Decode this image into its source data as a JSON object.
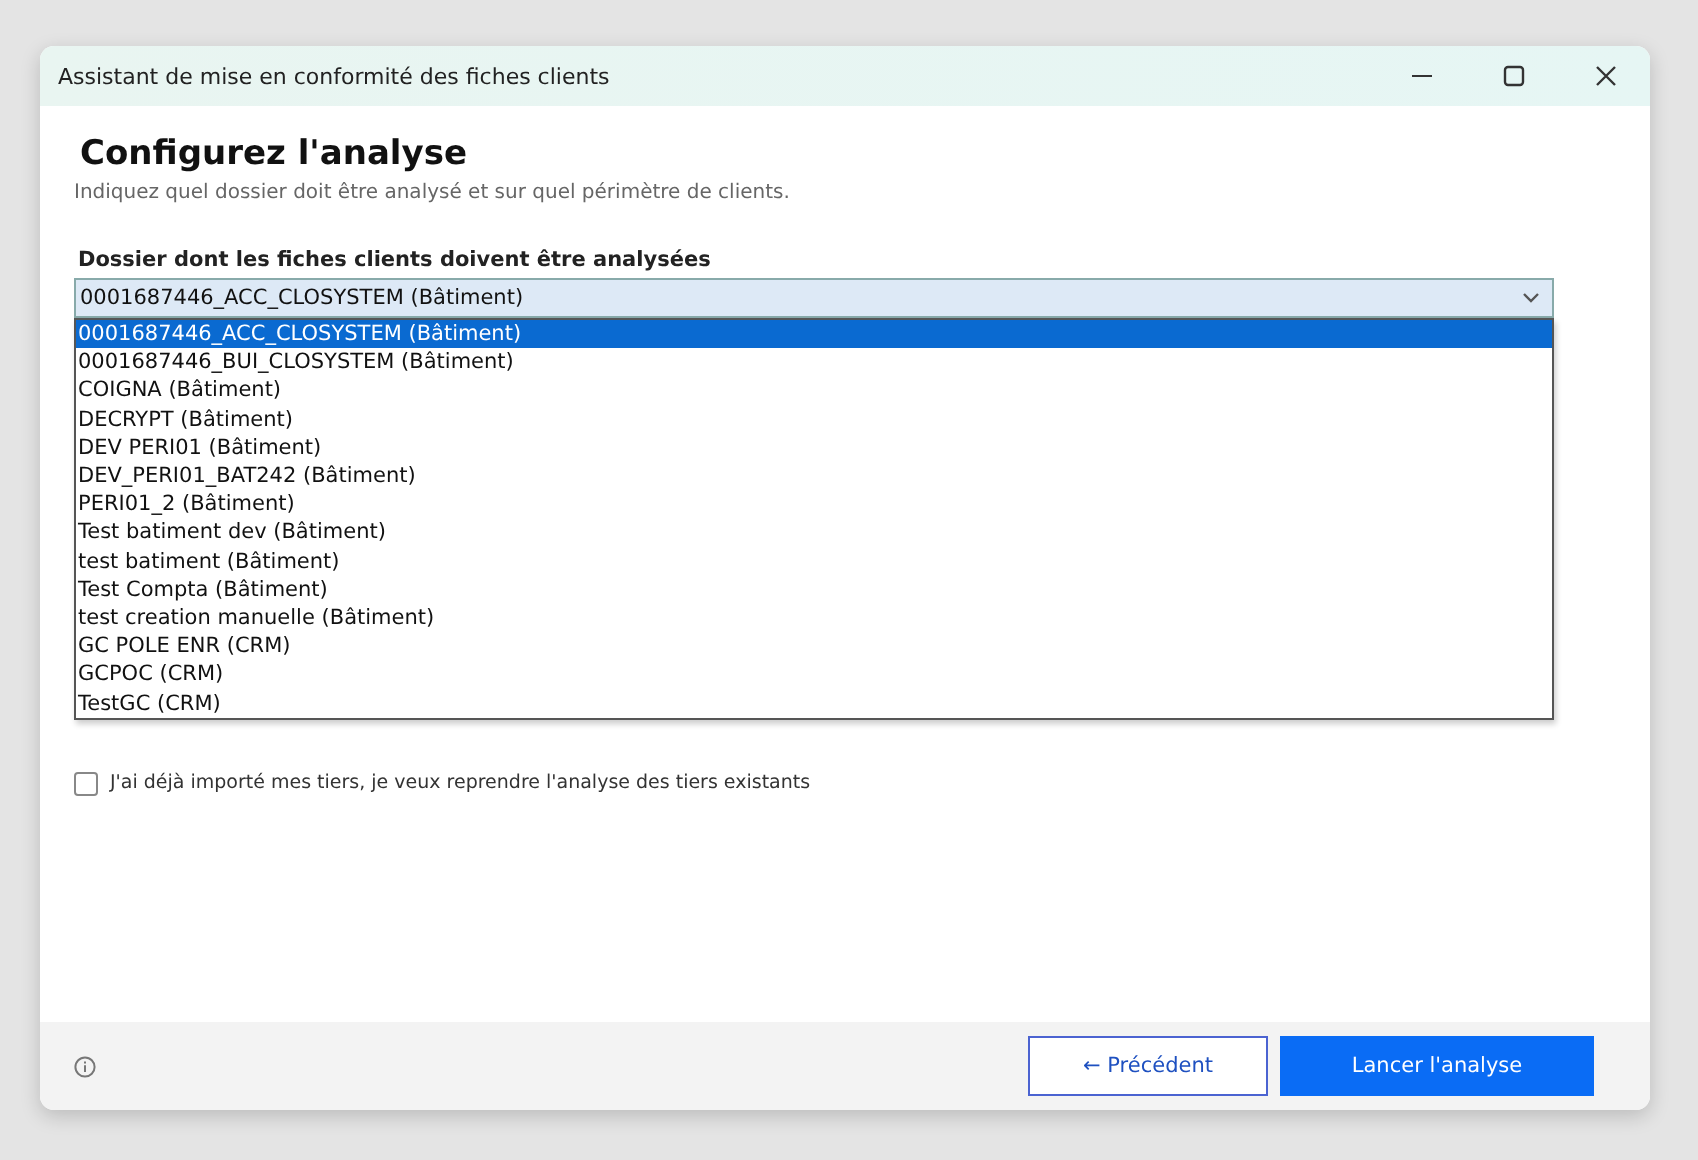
{
  "window": {
    "title": "Assistant de mise en conformité des fiches clients"
  },
  "heading": "Configurez l'analyse",
  "subtitle": "Indiquez quel dossier doit être analysé et sur quel périmètre de clients.",
  "folder_field": {
    "label": "Dossier dont les fiches clients doivent être analysées",
    "value": "0001687446_ACC_CLOSYSTEM (Bâtiment)",
    "expanded": true,
    "options": [
      {
        "label": "0001687446_ACC_CLOSYSTEM (Bâtiment)",
        "selected": true
      },
      {
        "label": "0001687446_BUI_CLOSYSTEM (Bâtiment)",
        "selected": false
      },
      {
        "label": "COIGNA (Bâtiment)",
        "selected": false
      },
      {
        "label": "DECRYPT (Bâtiment)",
        "selected": false
      },
      {
        "label": "DEV PERI01 (Bâtiment)",
        "selected": false
      },
      {
        "label": "DEV_PERI01_BAT242 (Bâtiment)",
        "selected": false
      },
      {
        "label": "PERI01_2 (Bâtiment)",
        "selected": false
      },
      {
        "label": "Test batiment dev (Bâtiment)",
        "selected": false
      },
      {
        "label": "test batiment (Bâtiment)",
        "selected": false
      },
      {
        "label": "Test Compta (Bâtiment)",
        "selected": false
      },
      {
        "label": "test creation manuelle (Bâtiment)",
        "selected": false
      },
      {
        "label": "GC POLE ENR (CRM)",
        "selected": false
      },
      {
        "label": "GCPOC (CRM)",
        "selected": false
      },
      {
        "label": "TestGC (CRM)",
        "selected": false
      }
    ]
  },
  "resume_checkbox": {
    "label": "J'ai déjà importé mes tiers, je veux reprendre l'analyse des tiers existants",
    "checked": false
  },
  "footer": {
    "buttons": [
      {
        "label": "← Précédent",
        "kind": "secondary"
      },
      {
        "label": "Lancer l'analyse",
        "kind": "primary"
      }
    ]
  }
}
